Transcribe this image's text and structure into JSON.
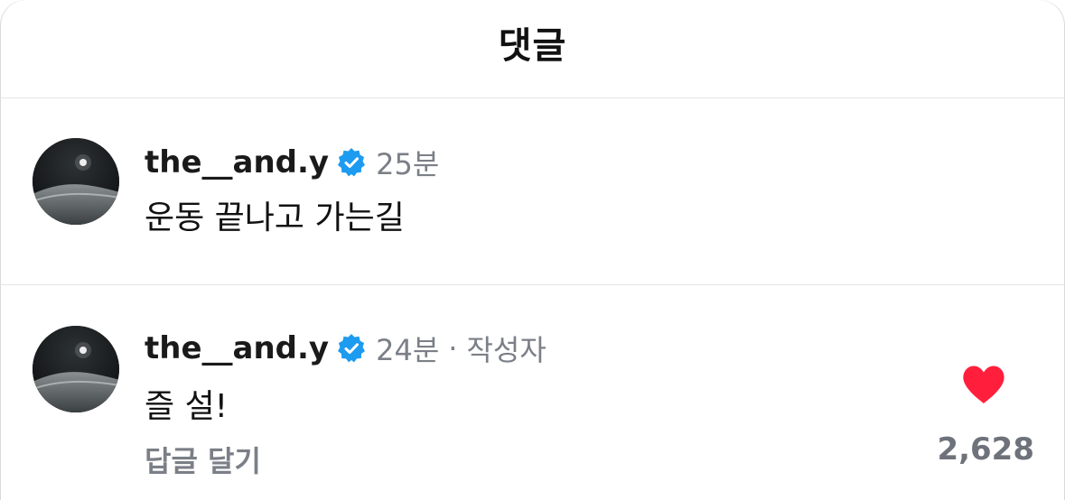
{
  "header": {
    "title": "댓글"
  },
  "comments": [
    {
      "username": "the__and.y",
      "verified_icon": "verified-badge-icon",
      "time": "25분",
      "text": "운동 끝나고 가는길"
    },
    {
      "username": "the__and.y",
      "verified_icon": "verified-badge-icon",
      "time": "24분",
      "separator": "·",
      "author_tag": "작성자",
      "text": "즐 설!",
      "reply_label": "답글 달기",
      "like_icon": "heart-filled-icon",
      "like_count": "2,628"
    }
  ],
  "colors": {
    "verified": "#1d9bf0",
    "heart": "#ff1f3d",
    "muted_text": "#7b7f87"
  }
}
